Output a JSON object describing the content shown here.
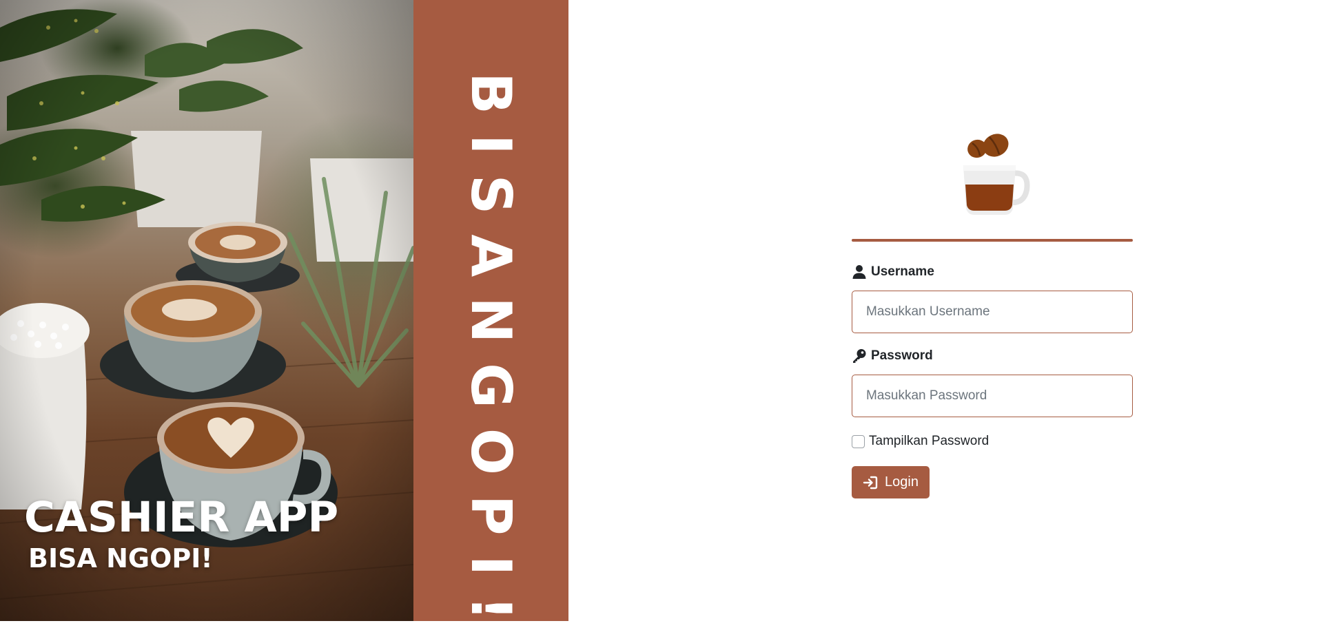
{
  "colors": {
    "accent": "#a65b41",
    "text": "#212529",
    "placeholder": "#6c757d",
    "white": "#ffffff"
  },
  "hero": {
    "title": "CASHIER APP",
    "subtitle": "BISA NGOPI!"
  },
  "brand": {
    "vertical_text": "BISANGOPI!"
  },
  "logo": {
    "icon": "coffee-cup-with-beans-icon"
  },
  "form": {
    "username": {
      "icon": "user-icon",
      "label": "Username",
      "placeholder": "Masukkan Username",
      "value": ""
    },
    "password": {
      "icon": "key-icon",
      "label": "Password",
      "placeholder": "Masukkan Password",
      "value": ""
    },
    "show_password": {
      "label": "Tampilkan Password",
      "checked": false
    },
    "login_button": {
      "icon": "sign-in-icon",
      "label": "Login"
    }
  }
}
